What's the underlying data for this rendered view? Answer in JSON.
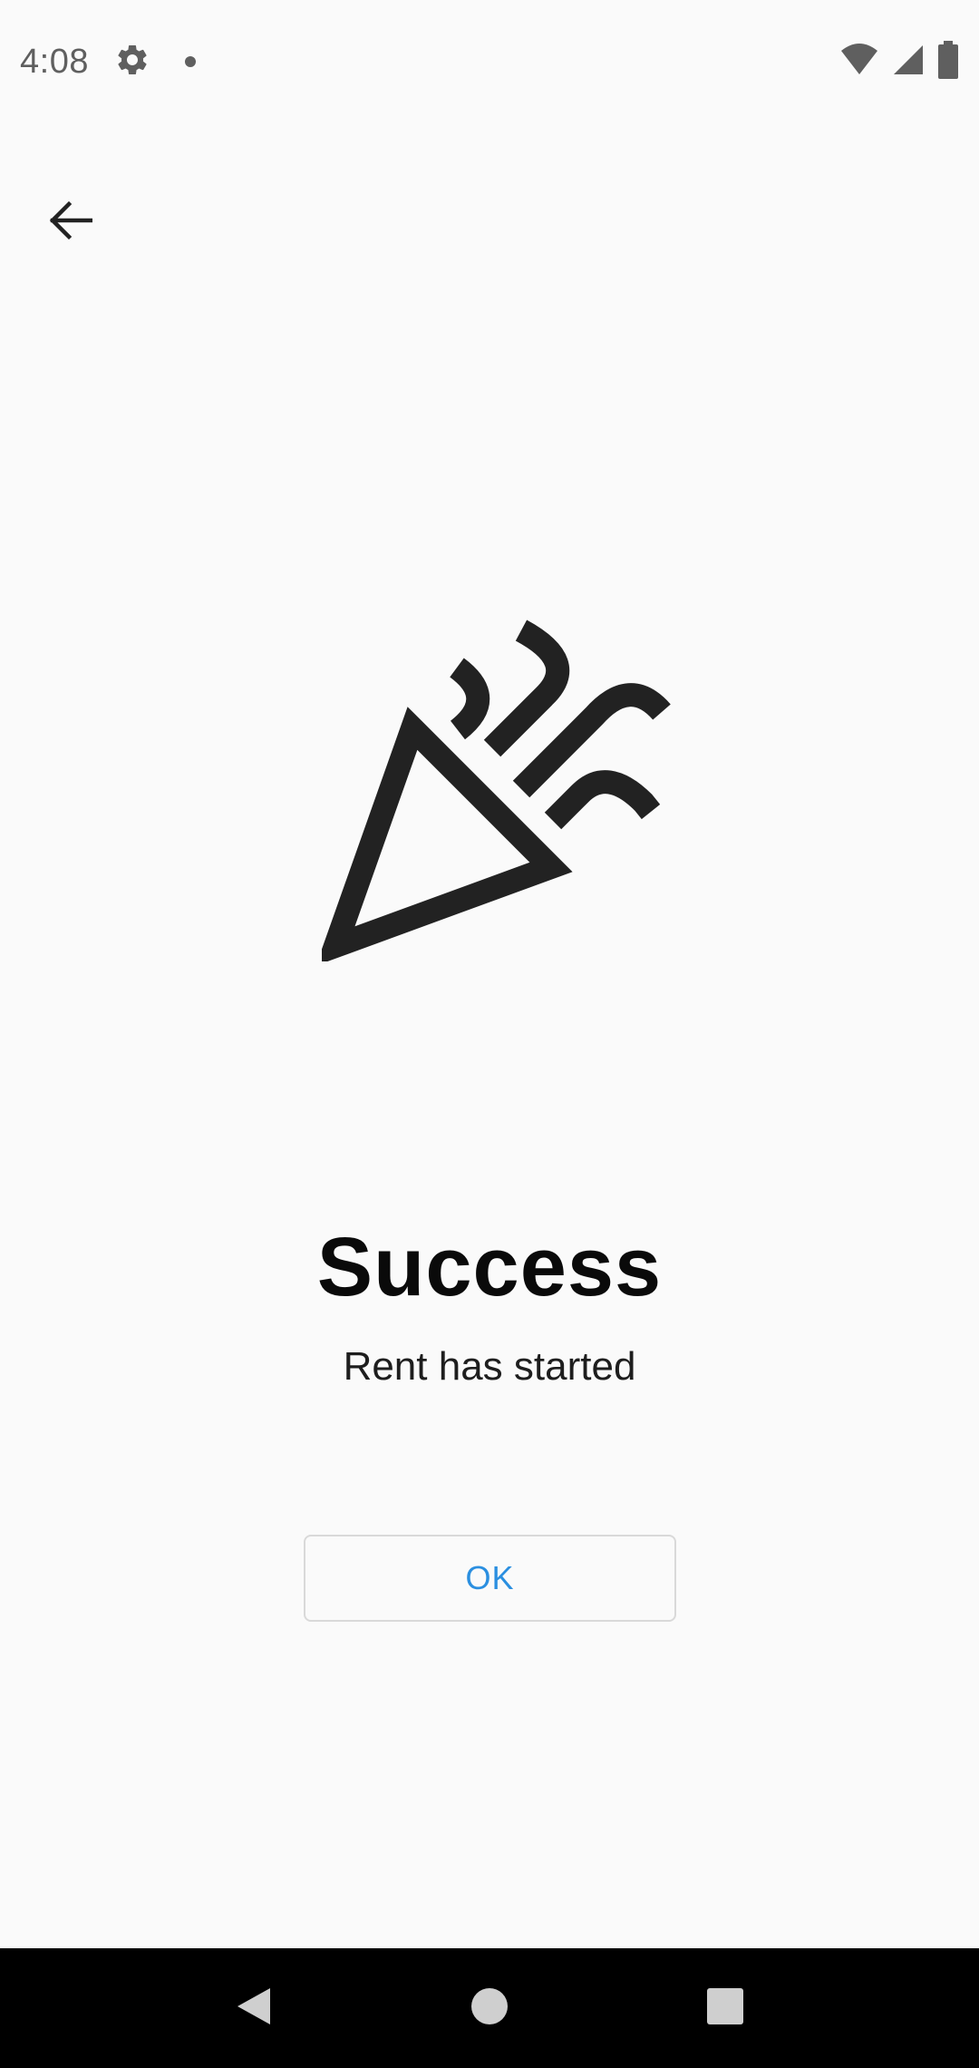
{
  "status_bar": {
    "time": "4:08",
    "icons": [
      "gear-icon",
      "notification-dot",
      "wifi-icon",
      "signal-icon",
      "battery-icon"
    ]
  },
  "header": {
    "back_icon": "arrow-left-icon"
  },
  "illustration": {
    "icon": "party-popper-icon"
  },
  "main": {
    "title": "Success",
    "subtitle": "Rent has started",
    "ok_label": "OK"
  },
  "nav_bar": {
    "buttons": [
      "back-triangle-icon",
      "home-circle-icon",
      "recents-square-icon"
    ]
  },
  "colors": {
    "background": "#fafafa",
    "accent": "#2b8fe0",
    "text": "#0a0a0a",
    "icon": "#222222"
  }
}
